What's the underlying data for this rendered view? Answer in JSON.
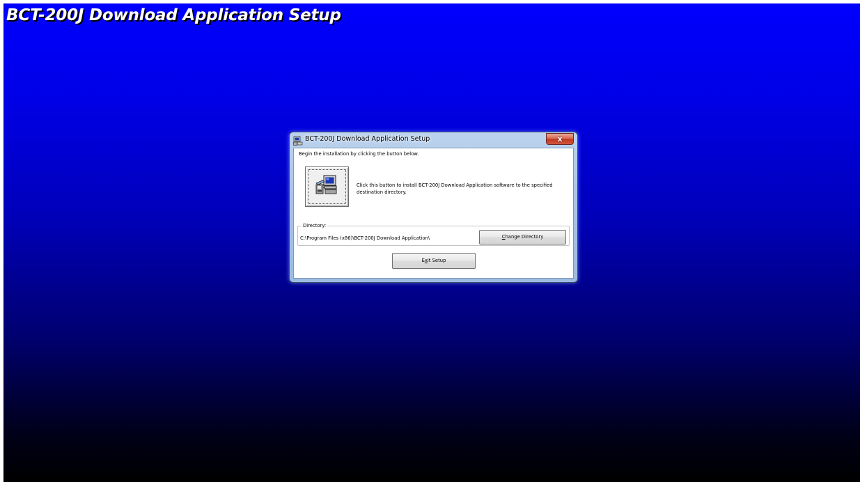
{
  "banner": {
    "title": "BCT-200J Download Application Setup"
  },
  "dialog": {
    "title": "BCT-200J Download Application Setup",
    "close_label": "x",
    "intro": "Begin the installation by clicking the button below.",
    "install_description": "Click this button to install BCT-200J Download Application software to the specified destination directory.",
    "directory": {
      "legend": "Directory:",
      "path": "C:\\Program Files (x86)\\BCT-200J Download Application\\",
      "change_button": {
        "pre": "",
        "accel": "C",
        "post": "hange Directory"
      }
    },
    "exit_button": {
      "pre": "E",
      "accel": "x",
      "post": "it Setup"
    }
  },
  "icons": {
    "title_icon": "setup-computer-icon",
    "install_icon": "install-computer-icon"
  },
  "colors": {
    "desktop_top": "#0000fe",
    "desktop_bottom": "#000000",
    "close_button": "#c0381f"
  }
}
